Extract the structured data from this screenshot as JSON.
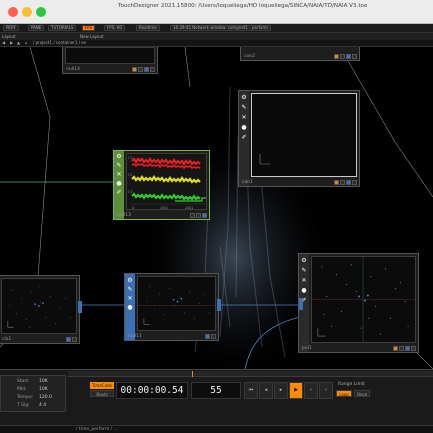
{
  "window": {
    "title": "TouchDesigner 2021.15800: /Users/loqueliega/HD loqueliega/SINCA/NAIA/TD/NAIA V3.toe"
  },
  "menubar": {
    "tabs": [
      "PERF",
      "PANE",
      "TUTORIALS",
      "FPS",
      "FPS: 60",
      "Realtime"
    ],
    "status": "16:29:45 Network window: compnet1 - perform"
  },
  "pathbar": {
    "left_label": "Layout",
    "right_label": "New Layout",
    "path": "/ project1 / container1 / ex"
  },
  "nodes": {
    "null14": {
      "name": "null14"
    },
    "con1": {
      "name": "con1"
    },
    "con2": {
      "name": "con2"
    },
    "null13": {
      "name": "null13",
      "axis": [
        "0",
        "1001",
        "2001",
        "1000"
      ],
      "channel_labels": [
        "C1",
        "C2",
        "C3"
      ]
    },
    "clx1": {
      "name": "clx1"
    },
    "null11": {
      "name": "null11"
    },
    "pol1": {
      "name": "pol1"
    }
  },
  "colors": {
    "accent": "#ff8a00",
    "selected_node": "#5d8f3a",
    "op_blue": "#3d6fb4",
    "chop_red": "#e31f1f",
    "chop_yellow": "#dddd22",
    "chop_green": "#2fd12f"
  },
  "timeline": {
    "info": [
      {
        "label": "Start:",
        "value": "10K"
      },
      {
        "label": "Mid:",
        "value": "10K"
      },
      {
        "label": "Tempo:",
        "value": "120.0"
      },
      {
        "label": "T Sig:",
        "value": "4 4"
      }
    ],
    "time_label": "TimeCode",
    "beats_label": "Beats",
    "timecode": "00:00:00.54",
    "frame": "55",
    "transport": [
      "⏮",
      "◂",
      "▸",
      "▶",
      "‹",
      "›",
      "⏭"
    ],
    "range_label": "Range Limit",
    "range_buttons": [
      "Loop",
      "Once"
    ],
    "timepath": "/ time_perform / ...",
    "marks": [
      "1",
      "2",
      "3",
      "4",
      "5"
    ]
  }
}
